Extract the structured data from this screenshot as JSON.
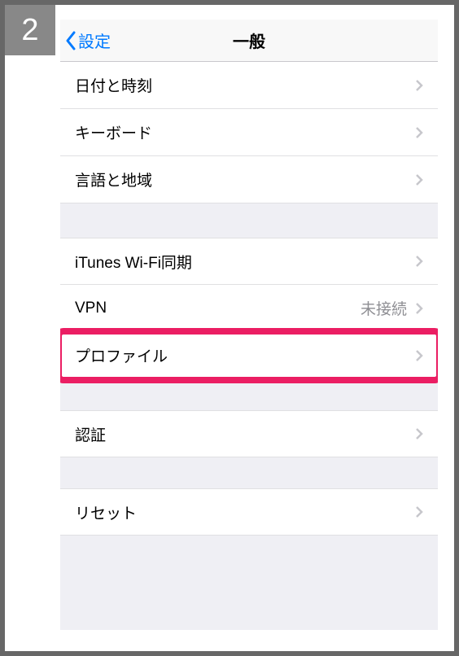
{
  "step_number": "2",
  "nav": {
    "back_label": "設定",
    "title": "一般"
  },
  "groups": [
    {
      "rows": [
        {
          "label": "日付と時刻",
          "value": "",
          "highlighted": false
        },
        {
          "label": "キーボード",
          "value": "",
          "highlighted": false
        },
        {
          "label": "言語と地域",
          "value": "",
          "highlighted": false
        }
      ]
    },
    {
      "rows": [
        {
          "label": "iTunes Wi-Fi同期",
          "value": "",
          "highlighted": false
        },
        {
          "label": "VPN",
          "value": "未接続",
          "highlighted": false
        },
        {
          "label": "プロファイル",
          "value": "",
          "highlighted": true
        }
      ]
    },
    {
      "rows": [
        {
          "label": "認証",
          "value": "",
          "highlighted": false
        }
      ]
    },
    {
      "rows": [
        {
          "label": "リセット",
          "value": "",
          "highlighted": false
        }
      ]
    }
  ]
}
